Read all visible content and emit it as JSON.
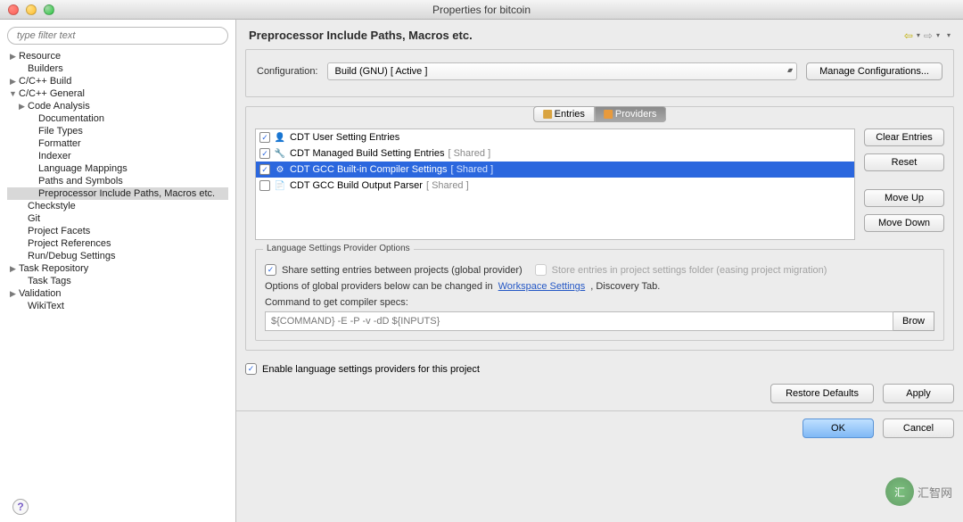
{
  "window": {
    "title": "Properties for bitcoin"
  },
  "sidebar": {
    "filter_placeholder": "type filter text",
    "items": [
      {
        "label": "Resource",
        "arrow": "▶",
        "ind": 0
      },
      {
        "label": "Builders",
        "arrow": "",
        "ind": 1
      },
      {
        "label": "C/C++ Build",
        "arrow": "▶",
        "ind": 0
      },
      {
        "label": "C/C++ General",
        "arrow": "▼",
        "ind": 0
      },
      {
        "label": "Code Analysis",
        "arrow": "▶",
        "ind": 1
      },
      {
        "label": "Documentation",
        "arrow": "",
        "ind": 2
      },
      {
        "label": "File Types",
        "arrow": "",
        "ind": 2
      },
      {
        "label": "Formatter",
        "arrow": "",
        "ind": 2
      },
      {
        "label": "Indexer",
        "arrow": "",
        "ind": 2
      },
      {
        "label": "Language Mappings",
        "arrow": "",
        "ind": 2
      },
      {
        "label": "Paths and Symbols",
        "arrow": "",
        "ind": 2
      },
      {
        "label": "Preprocessor Include Paths, Macros etc.",
        "arrow": "",
        "ind": 2,
        "selected": true
      },
      {
        "label": "Checkstyle",
        "arrow": "",
        "ind": 1
      },
      {
        "label": "Git",
        "arrow": "",
        "ind": 1
      },
      {
        "label": "Project Facets",
        "arrow": "",
        "ind": 1
      },
      {
        "label": "Project References",
        "arrow": "",
        "ind": 1
      },
      {
        "label": "Run/Debug Settings",
        "arrow": "",
        "ind": 1
      },
      {
        "label": "Task Repository",
        "arrow": "▶",
        "ind": 0
      },
      {
        "label": "Task Tags",
        "arrow": "",
        "ind": 1
      },
      {
        "label": "Validation",
        "arrow": "▶",
        "ind": 0
      },
      {
        "label": "WikiText",
        "arrow": "",
        "ind": 1
      }
    ]
  },
  "page": {
    "title": "Preprocessor Include Paths, Macros etc.",
    "config_label": "Configuration:",
    "config_value": "Build (GNU)  [ Active ]",
    "manage_btn": "Manage Configurations...",
    "tabs": {
      "entries": "Entries",
      "providers": "Providers"
    },
    "providers": [
      {
        "checked": true,
        "icon": "👤",
        "label": "CDT User Setting Entries",
        "shared": ""
      },
      {
        "checked": true,
        "icon": "🔧",
        "label": "CDT Managed Build Setting Entries",
        "shared": "  [ Shared ]"
      },
      {
        "checked": true,
        "icon": "⚙",
        "label": "CDT GCC Built-in Compiler Settings",
        "shared": "  [ Shared ]",
        "selected": true
      },
      {
        "checked": false,
        "icon": "📄",
        "label": "CDT GCC Build Output Parser",
        "shared": "  [ Shared ]"
      }
    ],
    "side_buttons": {
      "clear": "Clear Entries",
      "reset": "Reset",
      "up": "Move Up",
      "down": "Move Down"
    },
    "options": {
      "group_label": "Language Settings Provider Options",
      "share_label": "Share setting entries between projects (global provider)",
      "store_label": "Store entries in project settings folder (easing project migration)",
      "global_text_a": "Options of global providers below can be changed in ",
      "global_link": "Workspace Settings",
      "global_text_b": ", Discovery Tab.",
      "cmd_label": "Command to get compiler specs:",
      "cmd_value": "${COMMAND} -E -P -v -dD ${INPUTS}",
      "browse": "Brow"
    },
    "enable_label": "Enable language settings providers for this project",
    "footer": {
      "restore": "Restore Defaults",
      "apply": "Apply",
      "ok": "OK",
      "cancel": "Cancel"
    }
  },
  "watermark": {
    "text": "汇智网"
  }
}
